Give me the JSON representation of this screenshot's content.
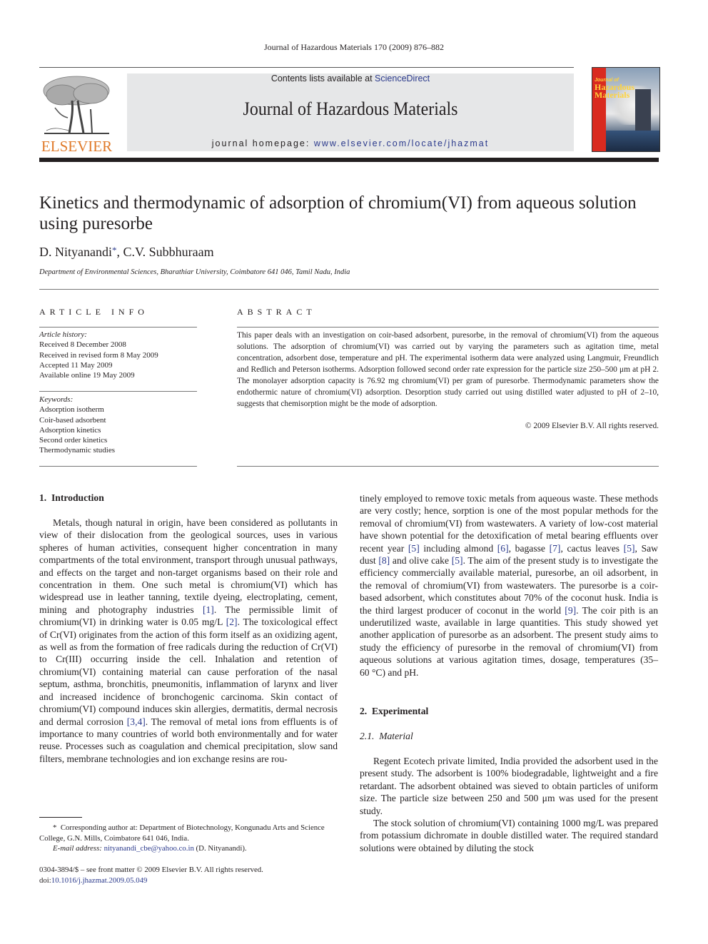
{
  "running_head": "Journal of Hazardous Materials 170 (2009) 876–882",
  "header": {
    "publisher_logo_text": "ELSEVIER",
    "contents_prefix": "Contents lists available at ",
    "contents_link": "ScienceDirect",
    "journal_title": "Journal of Hazardous Materials",
    "homepage_prefix": "journal homepage: ",
    "homepage_link": "www.elsevier.com/locate/jhazmat",
    "cover": {
      "line1": "Journal of",
      "line2": "Hazardous",
      "line3": "Materials"
    },
    "colors": {
      "elsevier_orange": "#e07a2a",
      "link_blue": "#2b3a8c",
      "banner_gray": "#e6e7e8",
      "cover_red": "#d92a1f"
    }
  },
  "article": {
    "title": "Kinetics and thermodynamic of adsorption of chromium(VI) from aqueous solution using puresorbe",
    "authors": [
      {
        "name": "D. Nityanandi",
        "mark": "*"
      },
      {
        "name": "C.V. Subbhuraam",
        "mark": ""
      }
    ],
    "author_separator": ", ",
    "affiliation": "Department of Environmental Sciences, Bharathiar University, Coimbatore 641 046, Tamil Nadu, India"
  },
  "article_info": {
    "heading": "ARTICLE INFO",
    "history_label": "Article history:",
    "history": [
      "Received 8 December 2008",
      "Received in revised form 8 May 2009",
      "Accepted 11 May 2009",
      "Available online 19 May 2009"
    ],
    "keywords_label": "Keywords:",
    "keywords": [
      "Adsorption isotherm",
      "Coir-based adsorbent",
      "Adsorption kinetics",
      "Second order kinetics",
      "Thermodynamic studies"
    ]
  },
  "abstract": {
    "heading": "ABSTRACT",
    "text": "This paper deals with an investigation on coir-based adsorbent, puresorbe, in the removal of chromium(VI) from the aqueous solutions. The adsorption of chromium(VI) was carried out by varying the parameters such as agitation time, metal concentration, adsorbent dose, temperature and pH. The experimental isotherm data were analyzed using Langmuir, Freundlich and Redlich and Peterson isotherms. Adsorption followed second order rate expression for the particle size 250–500 μm at pH 2. The monolayer adsorption capacity is 76.92 mg chromium(VI) per gram of puresorbe. Thermodynamic parameters show the endothermic nature of chromium(VI) adsorption. Desorption study carried out using distilled water adjusted to pH of 2–10, suggests that chemisorption might be the mode of adsorption.",
    "copyright": "© 2009 Elsevier B.V. All rights reserved."
  },
  "sections": {
    "intro_heading": "1.  Introduction",
    "intro_left": [
      {
        "t": "Metals, though natural in origin, have been considered as pollutants in view of their dislocation from the geological sources, uses in various spheres of human activities, consequent higher concentration in many compartments of the total environment, transport through unusual pathways, and effects on the target and non-target organisms based on their role and concentration in them. One such metal is chromium(VI) which has widespread use in leather tanning, textile dyeing, electroplating, cement, mining and photography industries "
      },
      {
        "ref": "[1]"
      },
      {
        "t": ". The permissible limit of chromium(VI) in drinking water is 0.05 mg/L "
      },
      {
        "ref": "[2]"
      },
      {
        "t": ". The toxicological effect of Cr(VI) originates from the action of this form itself as an oxidizing agent, as well as from the formation of free radicals during the reduction of Cr(VI) to Cr(III) occurring inside the cell. Inhalation and retention of chromium(VI) containing material can cause perforation of the nasal septum, asthma, bronchitis, pneumonitis, inflammation of larynx and liver and increased incidence of bronchogenic carcinoma. Skin contact of chromium(VI) compound induces skin allergies, dermatitis, dermal necrosis and dermal corrosion "
      },
      {
        "ref": "[3,4]"
      },
      {
        "t": ". The removal of metal ions from effluents is of importance to many countries of world both environmentally and for water reuse. Processes such as coagulation and chemical precipitation, slow sand filters, membrane technologies and ion exchange resins are rou-"
      }
    ],
    "intro_right": [
      {
        "t": "tinely employed to remove toxic metals from aqueous waste. These methods are very costly; hence, sorption is one of the most popular methods for the removal of chromium(VI) from wastewaters. A variety of low-cost material have shown potential for the detoxification of metal bearing effluents over recent year "
      },
      {
        "ref": "[5]"
      },
      {
        "t": " including almond "
      },
      {
        "ref": "[6]"
      },
      {
        "t": ", bagasse "
      },
      {
        "ref": "[7]"
      },
      {
        "t": ", cactus leaves "
      },
      {
        "ref": "[5]"
      },
      {
        "t": ", Saw dust "
      },
      {
        "ref": "[8]"
      },
      {
        "t": " and olive cake "
      },
      {
        "ref": "[5]"
      },
      {
        "t": ". The aim of the present study is to investigate the efficiency commercially available material, puresorbe, an oil adsorbent, in the removal of chromium(VI) from wastewaters. The puresorbe is a coir-based adsorbent, which constitutes about 70% of the coconut husk. India is the third largest producer of coconut in the world "
      },
      {
        "ref": "[9]"
      },
      {
        "t": ". The coir pith is an underutilized waste, available in large quantities. This study showed yet another application of puresorbe as an adsorbent. The present study aims to study the efficiency of puresorbe in the removal of chromium(VI) from aqueous solutions at various agitation times, dosage, temperatures (35–60 °C) and pH."
      }
    ],
    "experimental_heading": "2.  Experimental",
    "material_heading": "2.1.  Material",
    "material_paragraphs": [
      "Regent Ecotech private limited, India provided the adsorbent used in the present study. The adsorbent is 100% biodegradable, lightweight and a fire retardant. The adsorbent obtained was sieved to obtain particles of uniform size. The particle size between 250 and 500 μm was used for the present study.",
      "The stock solution of chromium(VI) containing 1000 mg/L was prepared from potassium dichromate in double distilled water. The required standard solutions were obtained by diluting the stock"
    ]
  },
  "footnote": {
    "mark": "*",
    "text": "Corresponding author at: Department of Biotechnology, Kongunadu Arts and Science College, G.N. Mills, Coimbatore 641 046, India.",
    "email_label": "E-mail address: ",
    "email": "nityanandi_cbe@yahoo.co.in",
    "email_suffix": " (D. Nityanandi)."
  },
  "issn": {
    "line": "0304-3894/$ – see front matter © 2009 Elsevier B.V. All rights reserved.",
    "doi_label": "doi:",
    "doi": "10.1016/j.jhazmat.2009.05.049"
  }
}
